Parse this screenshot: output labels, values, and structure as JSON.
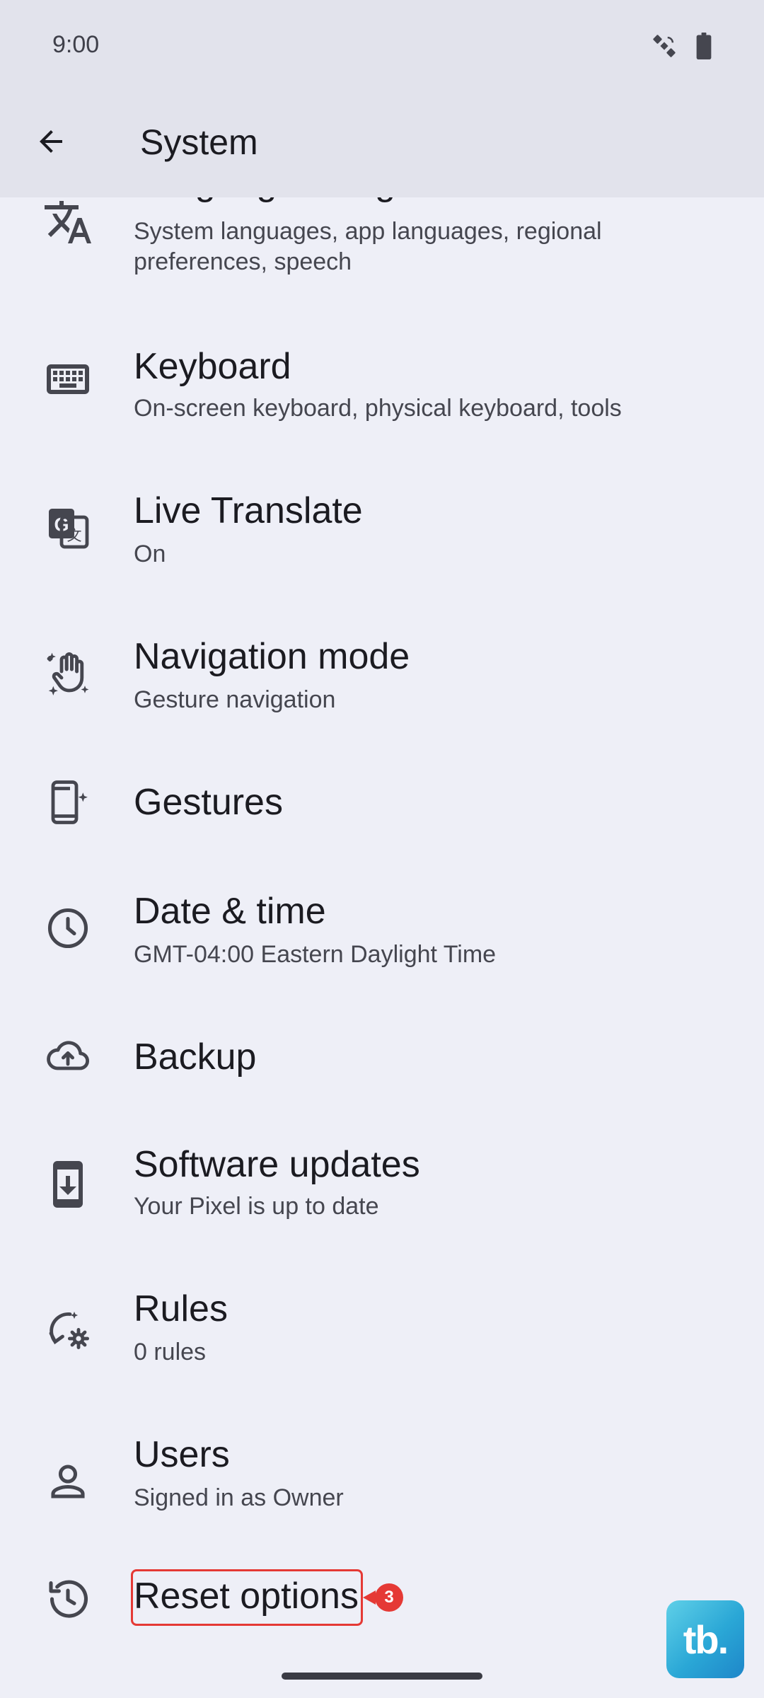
{
  "status": {
    "time": "9:00",
    "icons": [
      "satellite-icon",
      "battery-icon"
    ]
  },
  "appbar": {
    "title": "System",
    "back_icon": "arrow-back-icon"
  },
  "items": [
    {
      "title": "Language & region",
      "subtitle": "System languages, app languages, regional preferences, speech",
      "icon": "translate-icon"
    },
    {
      "title": "Keyboard",
      "subtitle": "On-screen keyboard, physical keyboard, tools",
      "icon": "keyboard-icon"
    },
    {
      "title": "Live Translate",
      "subtitle": "On",
      "icon": "g-translate-icon"
    },
    {
      "title": "Navigation mode",
      "subtitle": "Gesture navigation",
      "icon": "gesture-hand-icon"
    },
    {
      "title": "Gestures",
      "subtitle": "",
      "icon": "phone-sparkle-icon"
    },
    {
      "title": "Date & time",
      "subtitle": "GMT-04:00 Eastern Daylight Time",
      "icon": "clock-icon"
    },
    {
      "title": "Backup",
      "subtitle": "",
      "icon": "cloud-upload-icon"
    },
    {
      "title": "Software updates",
      "subtitle": "Your Pixel is up to date",
      "icon": "system-update-icon"
    },
    {
      "title": "Rules",
      "subtitle": "0 rules",
      "icon": "rules-gear-icon"
    },
    {
      "title": "Users",
      "subtitle": "Signed in as Owner",
      "icon": "person-icon"
    },
    {
      "title": "Reset options",
      "subtitle": "",
      "icon": "history-icon"
    }
  ],
  "annotation": {
    "badge": "3",
    "color": "#E53935"
  },
  "watermark": {
    "text": "tb."
  }
}
